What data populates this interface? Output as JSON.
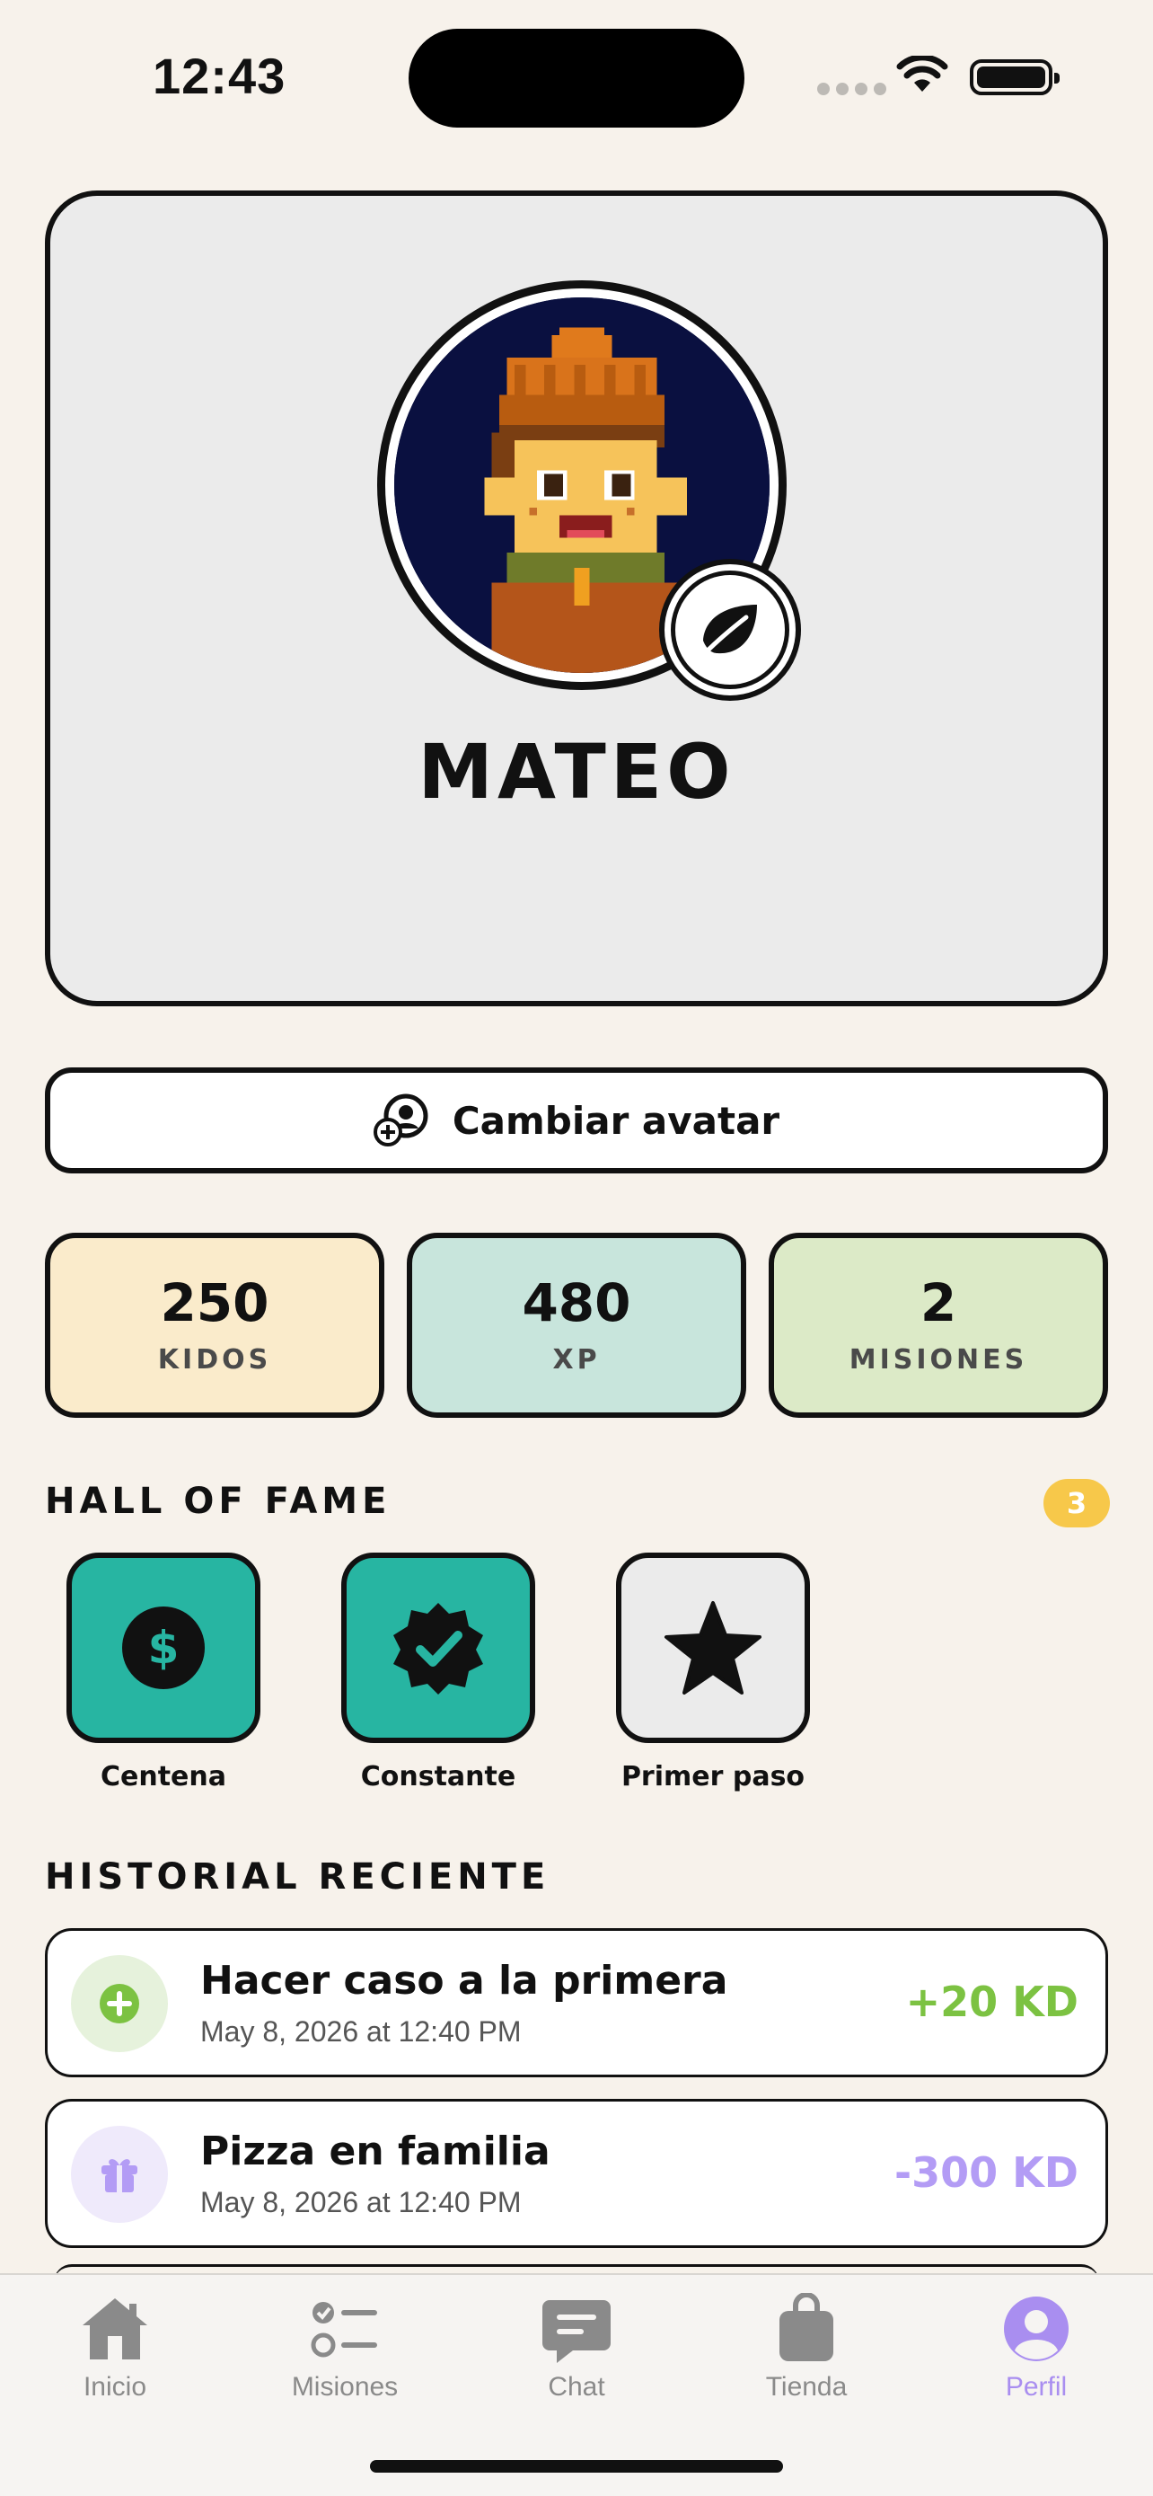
{
  "status_bar": {
    "time": "12:43"
  },
  "profile": {
    "name": "MATEO",
    "avatar_icon": "pixel-boy-avatar",
    "badge_icon": "leaf-icon"
  },
  "change_avatar": {
    "label": "Cambiar avatar",
    "icon": "avatar-swap-icon"
  },
  "stats": [
    {
      "value": "250",
      "label": "KIDOS",
      "color": "#faebcb"
    },
    {
      "value": "480",
      "label": "XP",
      "color": "#c8e5dc"
    },
    {
      "value": "2",
      "label": "MISIONES",
      "color": "#dceac7"
    }
  ],
  "hall_of_fame": {
    "title": "HALL OF FAME",
    "count": "3",
    "items": [
      {
        "label": "Centena",
        "icon": "dollar-coin-icon",
        "color": "#27b5a2"
      },
      {
        "label": "Constante",
        "icon": "check-badge-icon",
        "color": "#27b5a2"
      },
      {
        "label": "Primer paso",
        "icon": "star-icon",
        "color": "#ebebeb"
      }
    ]
  },
  "history": {
    "title": "HISTORIAL RECIENTE",
    "items": [
      {
        "title": "Hacer caso a la primera",
        "date": "May 8, 2026 at 12:40 PM",
        "amount": "+20 KD",
        "icon": "plus-circle-icon",
        "color": "#7cc242"
      },
      {
        "title": "Pizza en familia",
        "date": "May 8, 2026 at 12:40 PM",
        "amount": "-300 KD",
        "icon": "gift-icon",
        "color": "#b39cf5"
      }
    ]
  },
  "tabs": [
    {
      "label": "Inicio",
      "icon": "home-icon"
    },
    {
      "label": "Misiones",
      "icon": "checklist-icon"
    },
    {
      "label": "Chat",
      "icon": "chat-bubble-icon"
    },
    {
      "label": "Tienda",
      "icon": "shopping-bag-icon"
    },
    {
      "label": "Perfil",
      "icon": "person-circle-icon",
      "active": true
    }
  ]
}
